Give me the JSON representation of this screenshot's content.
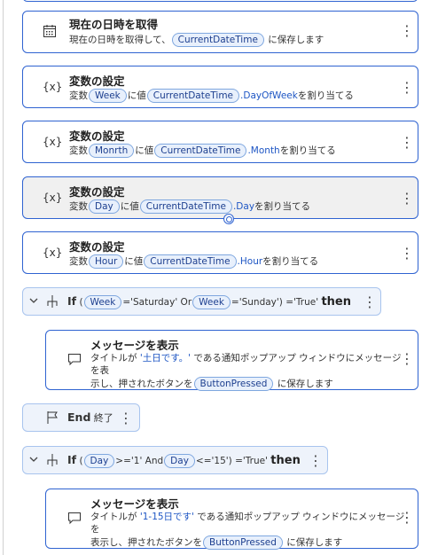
{
  "steps": [
    {
      "title": "現在の日時を取得",
      "desc_pre": "現在の日時を取得して、",
      "var": "CurrentDateTime",
      "desc_post": "に保存します"
    },
    {
      "title": "変数の設定",
      "lbl_var": "変数",
      "var": "Week",
      "lbl_val": "に値",
      "val": "CurrentDateTime",
      "prop": ".DayOfWeek",
      "suffix": "を割り当てる"
    },
    {
      "title": "変数の設定",
      "lbl_var": "変数",
      "var": "Monrth",
      "lbl_val": "に値",
      "val": "CurrentDateTime",
      "prop": ".Month",
      "suffix": "を割り当てる"
    },
    {
      "title": "変数の設定",
      "lbl_var": "変数",
      "var": "Day",
      "lbl_val": "に値",
      "val": "CurrentDateTime",
      "prop": ".Day",
      "suffix": "を割り当てる"
    },
    {
      "title": "変数の設定",
      "lbl_var": "変数",
      "var": "Hour",
      "lbl_val": "に値",
      "val": "CurrentDateTime",
      "prop": ".Hour",
      "suffix": "を割り当てる"
    }
  ],
  "if1": {
    "kw": "If",
    "open": "(",
    "var1": "Week",
    "cond1": "='Saturday' Or",
    "var2": "Week",
    "cond2": "='Sunday') ='True'",
    "then": "then"
  },
  "msg1": {
    "title": "メッセージを表示",
    "pre": "タイトルが",
    "str": "'土日です。'",
    "line1_post": "である通知ポップアップ ウィンドウにメッセージ を表",
    "line2_pre": "示し、押されたボタンを",
    "var": "ButtonPressed",
    "line2_post": "に保存します"
  },
  "end": {
    "kw": "End",
    "sub": "終了"
  },
  "if2": {
    "kw": "If",
    "open": "(",
    "var1": "Day",
    "cond1": ">='1' And",
    "var2": "Day",
    "cond2": "<='15') ='True'",
    "then": "then"
  },
  "msg2": {
    "title": "メッセージを表示",
    "pre": "タイトルが",
    "str": "'1-15日です'",
    "line1_post": "である通知ポップアップ ウィンドウにメッセージ を",
    "line2_pre": "表示し、押されたボタンを",
    "var": "ButtonPressed",
    "line2_post": "に保存します"
  },
  "icons": {
    "calendar": "calendar-icon",
    "variable": "variable-icon",
    "condition": "if-branch-icon",
    "message": "message-icon",
    "flag": "flag-icon",
    "more": "more-vertical-icon",
    "chevron": "chevron-down-icon"
  },
  "colors": {
    "border": "#2f63d1",
    "pill_bg": "#e8f0fc",
    "pill_text": "#1d3f8f",
    "selected_bg": "#f0f0f0",
    "block_bg": "#eef3fb"
  }
}
